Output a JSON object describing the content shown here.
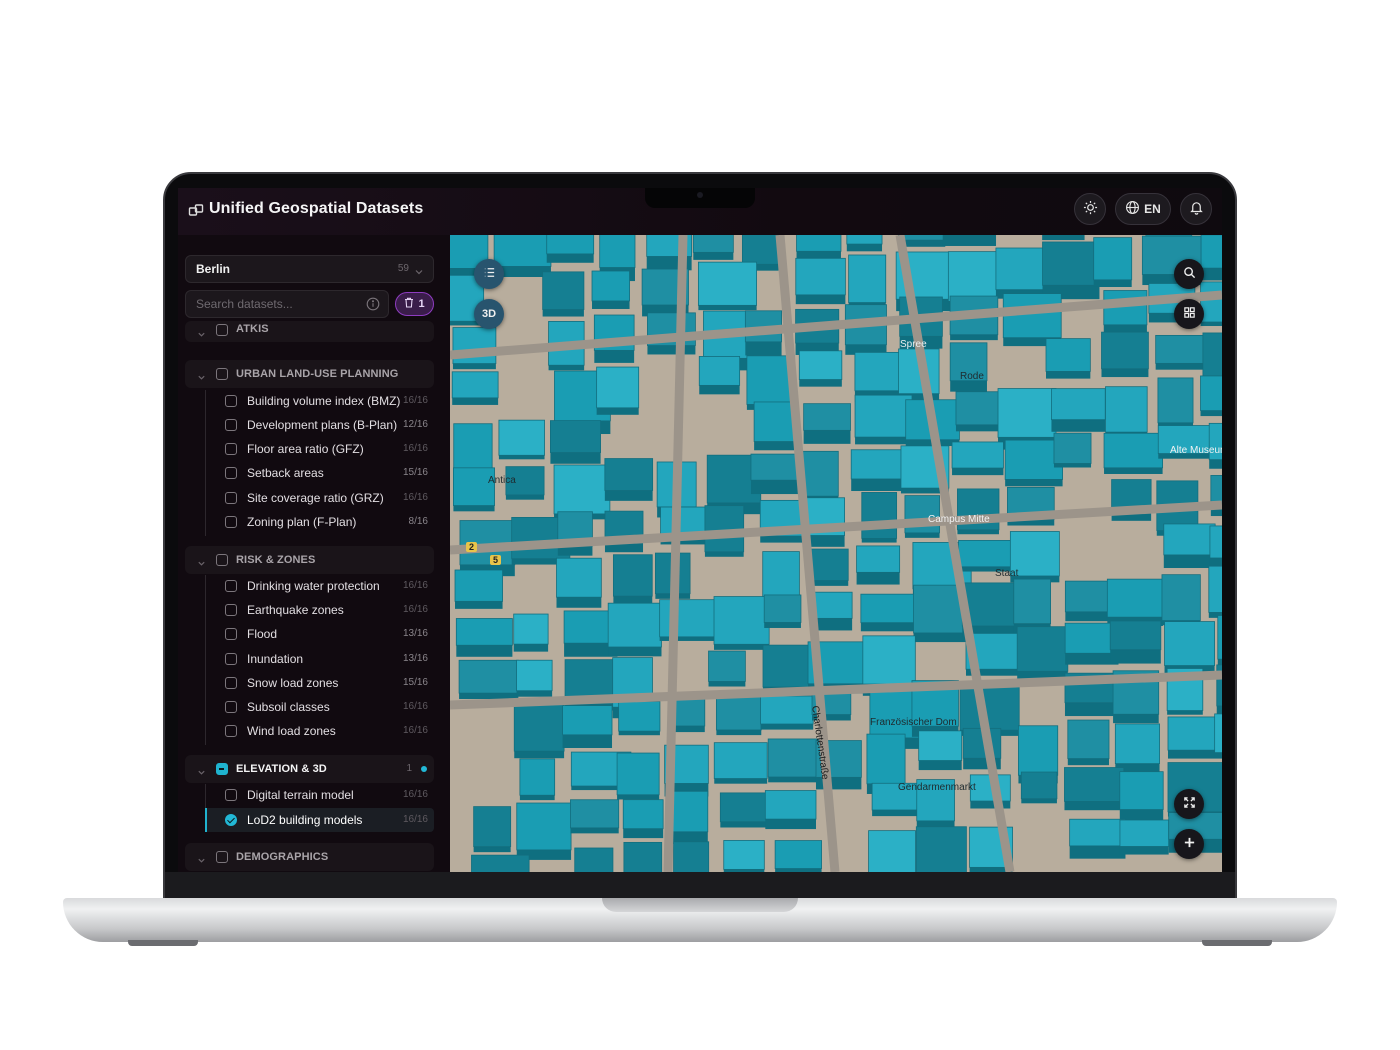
{
  "header": {
    "title": "Unified Geospatial Datasets",
    "language": "EN"
  },
  "sidebar": {
    "region": {
      "name": "Berlin",
      "count": "59"
    },
    "search": {
      "placeholder": "Search datasets..."
    },
    "filter_badge": "1",
    "groups": [
      {
        "label": "ATKIS"
      },
      {
        "label": "URBAN LAND-USE PLANNING",
        "items": [
          {
            "label": "Building volume index (BMZ)",
            "count": "16/16"
          },
          {
            "label": "Development plans (B-Plan)",
            "count": "12/16"
          },
          {
            "label": "Floor area ratio (GFZ)",
            "count": "16/16"
          },
          {
            "label": "Setback areas",
            "count": "15/16"
          },
          {
            "label": "Site coverage ratio (GRZ)",
            "count": "16/16"
          },
          {
            "label": "Zoning plan (F-Plan)",
            "count": "8/16"
          }
        ]
      },
      {
        "label": "RISK & ZONES",
        "items": [
          {
            "label": "Drinking water protection",
            "count": "16/16"
          },
          {
            "label": "Earthquake zones",
            "count": "16/16"
          },
          {
            "label": "Flood",
            "count": "13/16"
          },
          {
            "label": "Inundation",
            "count": "13/16"
          },
          {
            "label": "Snow load zones",
            "count": "15/16"
          },
          {
            "label": "Subsoil classes",
            "count": "16/16"
          },
          {
            "label": "Wind load zones",
            "count": "16/16"
          }
        ]
      },
      {
        "label": "ELEVATION & 3D",
        "count": "1",
        "items": [
          {
            "label": "Digital terrain model",
            "count": "16/16"
          },
          {
            "label": "LoD2 building models",
            "count": "16/16",
            "checked": true
          }
        ]
      },
      {
        "label": "DEMOGRAPHICS"
      }
    ]
  },
  "map": {
    "view_mode": "3D",
    "building_color": "#1a9db3",
    "street_labels": [
      "Charlottenstraße",
      "Spree",
      "Rode",
      "Antica",
      "Staat",
      "Campus Mitte",
      "Französischer Dom",
      "Alte Museum",
      "Gendarmenmarkt"
    ],
    "route_badges": [
      "2",
      "5"
    ]
  },
  "colors": {
    "accent": "#22b8d6",
    "filter_badge": "#8e3cc0",
    "sidebar_bg": "#110a10"
  },
  "icons": [
    "layers-icon",
    "sun-icon",
    "globe-icon",
    "bell-icon",
    "chevron-down-icon",
    "info-icon",
    "trash-icon",
    "list-icon",
    "search-icon",
    "grid-icon",
    "fullscreen-icon",
    "plus-icon"
  ]
}
